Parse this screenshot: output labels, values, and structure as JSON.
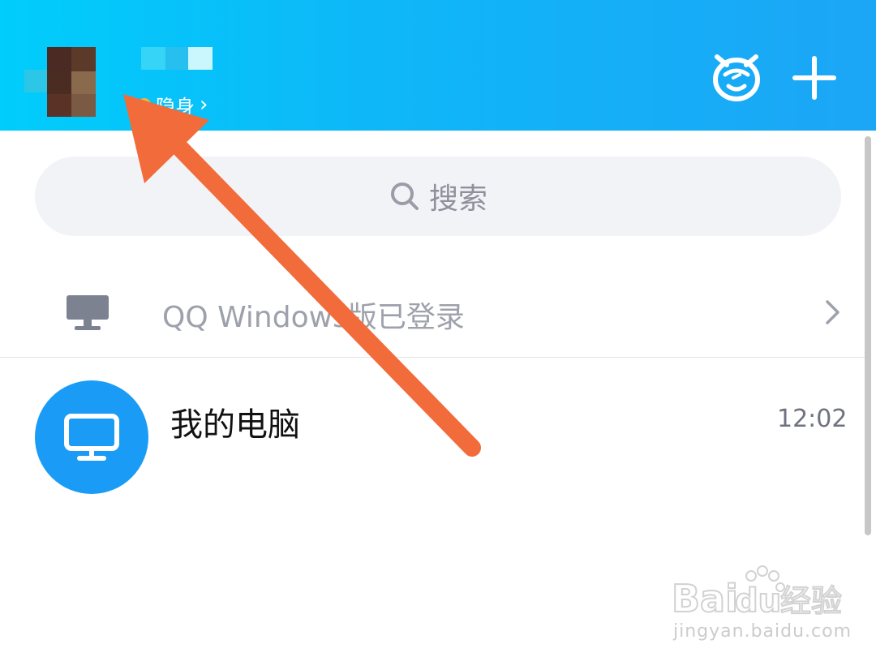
{
  "colors": {
    "header_start": "#00cdfb",
    "header_end": "#1ca6f6",
    "accent_blue": "#1a9cf6",
    "annotation_orange": "#f26b3a",
    "status_dot": "#f6b044"
  },
  "header": {
    "status_label": "隐身",
    "status_chevron": "›",
    "icons": {
      "mascot": "qq-mascot-icon",
      "plus": "plus-icon"
    }
  },
  "search": {
    "placeholder": "搜索",
    "icon": "search-icon"
  },
  "device_banner": {
    "icon": "desktop-icon",
    "text": "QQ Windows版已登录",
    "chevron": "chevron-right-icon"
  },
  "conversations": [
    {
      "title": "我的电脑",
      "time": "12:02",
      "icon": "monitor-icon"
    }
  ],
  "watermark": {
    "logo_text": "Baidu经验",
    "url": "jingyan.baidu.com"
  }
}
